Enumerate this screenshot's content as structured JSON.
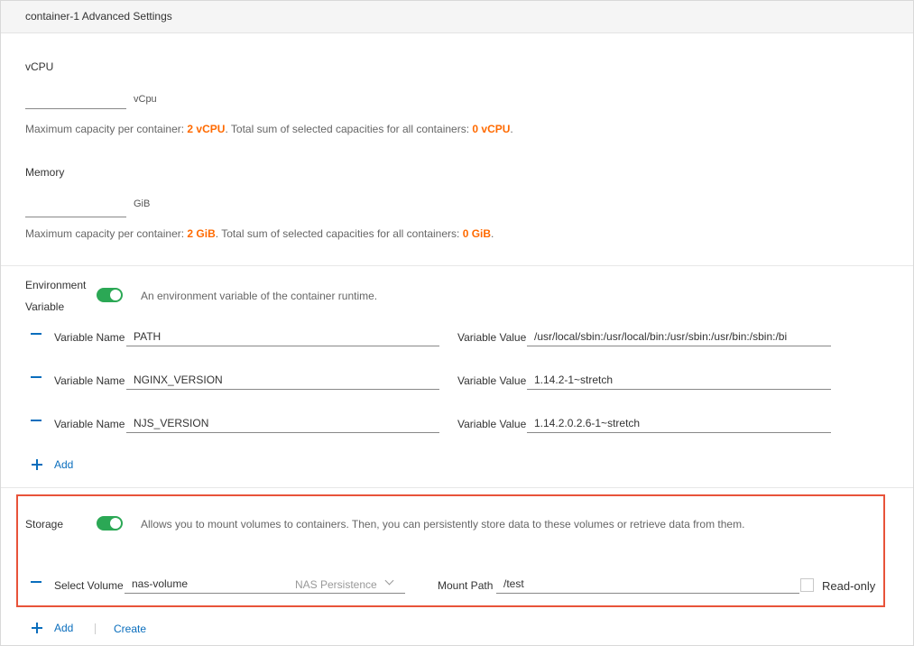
{
  "header": {
    "title": "container-1 Advanced Settings"
  },
  "vcpu": {
    "label": "vCPU",
    "value": "",
    "unit": "vCpu",
    "hint_prefix": "Maximum capacity per container:",
    "hint_max": "2 vCPU",
    "hint_middle": ". Total sum of selected capacities for all containers:",
    "hint_total": "0 vCPU",
    "hint_suffix": "."
  },
  "memory": {
    "label": "Memory",
    "value": "",
    "unit": "GiB",
    "hint_prefix": "Maximum capacity per container:",
    "hint_max": "2 GiB",
    "hint_middle": ". Total sum of selected capacities for all containers:",
    "hint_total": "0 GiB",
    "hint_suffix": "."
  },
  "env": {
    "label_line1": "Environment",
    "label_line2": "Variable",
    "enabled": true,
    "description": "An environment variable of the container runtime.",
    "name_label": "Variable Name",
    "value_label": "Variable Value",
    "rows": [
      {
        "name": "PATH",
        "value": "/usr/local/sbin:/usr/local/bin:/usr/sbin:/usr/bin:/sbin:/bi"
      },
      {
        "name": "NGINX_VERSION",
        "value": "1.14.2-1~stretch"
      },
      {
        "name": "NJS_VERSION",
        "value": "1.14.2.0.2.6-1~stretch"
      }
    ],
    "add_label": "Add"
  },
  "storage": {
    "label": "Storage",
    "enabled": true,
    "description": "Allows you to mount volumes to containers. Then, you can persistently store data to these volumes or retrieve data from them.",
    "select_volume_label": "Select Volume",
    "volume_name": "nas-volume",
    "volume_type_placeholder": "NAS Persistence",
    "mount_path_label": "Mount Path",
    "mount_path": "/test",
    "readonly_label": "Read-only",
    "readonly_checked": false,
    "add_label": "Add",
    "create_label": "Create"
  },
  "colors": {
    "accent": "#0a6ebd",
    "toggle_on": "#2ba855",
    "highlight": "#ff6a00",
    "callout_border": "#e8533a"
  }
}
